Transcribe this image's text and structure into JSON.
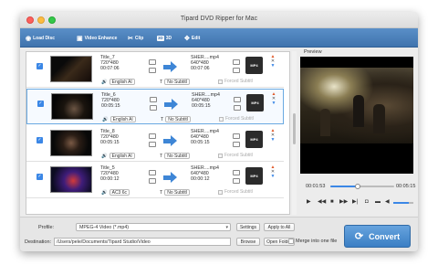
{
  "window": {
    "title": "Tipard DVD Ripper for Mac"
  },
  "toolbar": [
    {
      "label": "Load Disc",
      "icon": "disc-icon",
      "glyph": "◉"
    },
    {
      "label": "Video Enhance",
      "icon": "enhance-icon",
      "glyph": "▣"
    },
    {
      "label": "Clip",
      "icon": "scissors-icon",
      "glyph": "✂"
    },
    {
      "label": "3D",
      "icon": "3d-icon",
      "glyph": "3D"
    },
    {
      "label": "Edit",
      "icon": "edit-icon",
      "glyph": "✥"
    }
  ],
  "items": [
    {
      "title": "Title_7",
      "res": "720*480",
      "dur": "00:07:06",
      "out": "SHER....mp4",
      "out_res": "640*480",
      "out_dur": "00:07:06",
      "audio": "English Al",
      "subtitle": "No Subtitl",
      "forced": "Forced Subtitl",
      "format": "MP4"
    },
    {
      "title": "Title_6",
      "res": "720*480",
      "dur": "00:05:15",
      "out": "SHER....mp4",
      "out_res": "640*480",
      "out_dur": "00:05:15",
      "audio": "English Al",
      "subtitle": "No Subtitl",
      "forced": "Forced Subtitl",
      "format": "MP4"
    },
    {
      "title": "Title_8",
      "res": "720*480",
      "dur": "00:05:15",
      "out": "SHER....mp4",
      "out_res": "640*480",
      "out_dur": "00:05:15",
      "audio": "English Al",
      "subtitle": "No Subtitl",
      "forced": "Forced Subtitl",
      "format": "MP4"
    },
    {
      "title": "Title_5",
      "res": "720*480",
      "dur": "00:00:12",
      "out": "SHER....mp4",
      "out_res": "640*480",
      "out_dur": "00:00:12",
      "audio": "AC3 6c",
      "subtitle": "No Subtitl",
      "forced": "Forced Subtitl",
      "format": "MP4"
    }
  ],
  "preview": {
    "label": "Preview",
    "current": "00:01:53",
    "total": "00:05:15",
    "progress": 0.43,
    "volume": 0.75
  },
  "bottom": {
    "profile_label": "Profile:",
    "profile_value": "MPEG-4 Video (*.mp4)",
    "settings": "Settings",
    "apply_all": "Apply to All",
    "dest_label": "Destination:",
    "dest_value": "/Users/pele/Documents/Tipard Studio/Video",
    "browse": "Browse",
    "open_folder": "Open Folder",
    "merge": "Merge into one file",
    "convert": "Convert"
  },
  "colors": {
    "accent": "#3b87e6",
    "toolbar": "#4a80bb",
    "convert": "#4f8fd0"
  }
}
